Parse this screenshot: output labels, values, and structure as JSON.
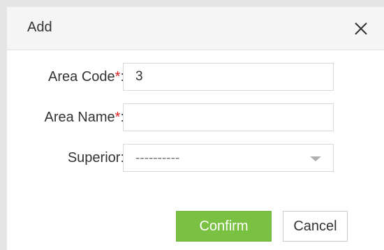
{
  "dialog": {
    "title": "Add",
    "close_icon": "close-icon"
  },
  "form": {
    "area_code": {
      "label": "Area Code",
      "required_mark": "*",
      "colon": ":",
      "value": "3"
    },
    "area_name": {
      "label": "Area Name",
      "required_mark": "*",
      "colon": ":",
      "value": ""
    },
    "superior": {
      "label": "Superior:",
      "selected": "----------"
    }
  },
  "buttons": {
    "confirm": "Confirm",
    "cancel": "Cancel"
  },
  "colors": {
    "confirm_bg": "#7ac143",
    "required": "#e02020"
  }
}
